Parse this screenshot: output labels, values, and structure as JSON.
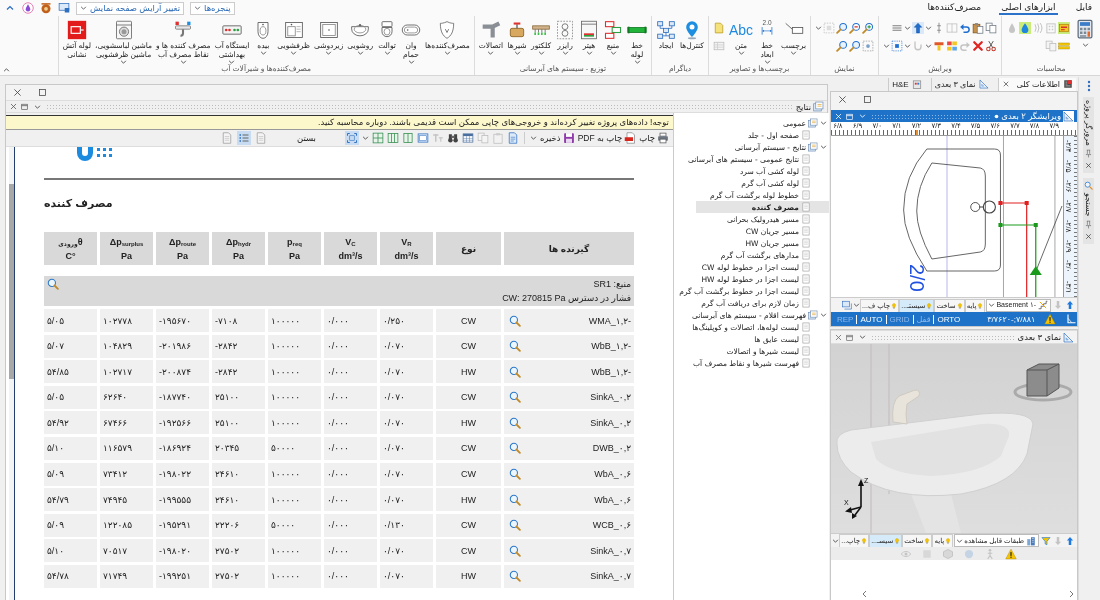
{
  "quick_access": {
    "layout_dropdown": "تغییر آرایش صفحه نمایش",
    "windows_dropdown": "پنجره‌ها"
  },
  "ribbon_tabs": [
    {
      "label": "فایل",
      "selected": false
    },
    {
      "label": "ابزارهای اصلی",
      "selected": true
    },
    {
      "label": "مصرف‌کننده‌ها",
      "selected": false
    }
  ],
  "ribbon_groups": [
    {
      "label": "محاسبات"
    },
    {
      "label": "ویرایش"
    },
    {
      "label": "نمایش"
    },
    {
      "label": "برچسب‌ها و تصاویر",
      "buttons": [
        {
          "label": "برچسب",
          "dropdown": true
        },
        {
          "label": "خط\nابعاد",
          "dropdown": true,
          "icon_text": "2.0"
        },
        {
          "label": "متن",
          "dropdown": true,
          "icon_text": "Abc"
        }
      ]
    },
    {
      "label": "دیاگرام",
      "buttons": [
        {
          "label": "کنترل‌ها",
          "dropdown": false
        },
        {
          "label": "ایجاد",
          "dropdown": false
        }
      ]
    },
    {
      "label": "توزیع - سیستم های آبرسانی",
      "buttons": [
        {
          "label": "خط\nلوله",
          "dropdown": true
        },
        {
          "label": "منبع",
          "dropdown": true
        },
        {
          "label": "هیتر",
          "dropdown": true
        },
        {
          "label": "رایزر",
          "dropdown": true
        },
        {
          "label": "کلکتور",
          "dropdown": true
        },
        {
          "label": "شیرها",
          "dropdown": true
        },
        {
          "label": "اتصالات",
          "dropdown": true
        }
      ]
    },
    {
      "label": "مصرف‌کننده‌ها و شیرآلات آب",
      "buttons": [
        {
          "label": "مصرف‌کننده‌ها",
          "dropdown": true
        },
        {
          "label": "وان\nحمام",
          "dropdown": true
        },
        {
          "label": "توالت",
          "dropdown": true
        },
        {
          "label": "روشویی",
          "dropdown": true
        },
        {
          "label": "زیردوشی",
          "dropdown": true
        },
        {
          "label": "ظرفشویی",
          "dropdown": true
        },
        {
          "label": "بیده",
          "dropdown": true
        },
        {
          "label": "ایستگاه آب\nبهداشتی",
          "dropdown": true
        },
        {
          "label": "مصرف کننده ها و\nنقاط مصرف آب",
          "dropdown": true
        },
        {
          "label": "ماشین لباسشویی،\nماشین ظرفشویی",
          "dropdown": true
        },
        {
          "label": "لوله آتش\nنشانی",
          "dropdown": false
        }
      ]
    }
  ],
  "document_tabs": [
    {
      "label": "اطلاعات کلی",
      "selected": true
    },
    {
      "label": "نمای ۳ بعدی",
      "selected": false
    },
    {
      "label": "H&E",
      "selected": false
    }
  ],
  "results_window": {
    "panel_title": "نتایج",
    "warning": "توجه! داده‌های پروژه تغییر کرده‌اند و خروجی‌های چاپی ممکن است قدیمی باشند. دوباره محاسبه کنید.",
    "toolbar": {
      "print": "چاپ",
      "print_pdf": "چاپ به PDF",
      "save": "ذخیره",
      "close": "بستن"
    },
    "fit_page": {
      "selected": true
    },
    "page_modes": [
      {
        "selected": false
      },
      {
        "selected": true
      },
      {
        "selected": false
      }
    ]
  },
  "report": {
    "title": "مصرف کننده",
    "columns": [
      {
        "name": "گیرنده ها"
      },
      {
        "name": "نوع"
      },
      {
        "name": "V$_{R}$",
        "unit": "dm³/s"
      },
      {
        "name": "V$_{C}$",
        "unit": "dm³/s"
      },
      {
        "name": "p$_{req}$",
        "unit": "Pa"
      },
      {
        "name": "Δp$_{hydr}$",
        "unit": "Pa"
      },
      {
        "name": "Δp$_{route}$",
        "unit": "Pa"
      },
      {
        "name": "Δp$_{surplus}$",
        "unit": "Pa"
      },
      {
        "name": "θ$_{ورودی}$",
        "unit": "°C"
      }
    ],
    "source": "منبع: SR1",
    "available_pressure": "فشار در دسترس CW: 270815 Pa",
    "rows": [
      [
        "WMA_۱,۲-",
        "CW",
        "۰/۲۵۰",
        "۰/۰۰۰",
        "۱۰۰۰۰۰",
        "-۷۱۰۸",
        "-۱۹۵۶۷۰",
        "۱۰۲۷۷۸",
        "۵/۰۵"
      ],
      [
        "WbB_۱,۲-",
        "CW",
        "۰/۰۷۰",
        "۰/۰۰۰",
        "۱۰۰۰۰۰",
        "-۲۸۴۲",
        "-۲۰۱۹۸۶",
        "۱۰۴۸۲۹",
        "۵/۰۷"
      ],
      [
        "WbB_۱,۲-",
        "HW",
        "۰/۰۷۰",
        "۰/۰۰۰",
        "۱۰۰۰۰۰",
        "-۲۸۴۲",
        "-۲۰۰۸۷۴",
        "۱۰۲۷۱۷",
        "۵۴/۸۵"
      ],
      [
        "SinkA_۰,۲",
        "CW",
        "۰/۰۷۰",
        "۰/۰۰۰",
        "۱۰۰۰۰۰",
        "۲۵۱۰۰",
        "-۱۸۷۷۴۰",
        "۶۲۶۴۰",
        "۵/۰۵"
      ],
      [
        "SinkA_۰,۲",
        "HW",
        "۰/۰۷۰",
        "۰/۰۰۰",
        "۱۰۰۰۰۰",
        "۲۵۱۰۰",
        "-۱۹۲۵۶۶",
        "۶۷۴۶۶",
        "۵۴/۹۲"
      ],
      [
        "DWB_۰,۲",
        "CW",
        "۰/۰۷۰",
        "۰/۰۰۰",
        "۵۰۰۰۰",
        "۲۰۳۴۵",
        "-۱۸۶۹۲۴",
        "۱۱۶۵۷۹",
        "۵/۱۰"
      ],
      [
        "WbA_۰,۶",
        "CW",
        "۰/۰۷۰",
        "۰/۰۰۰",
        "۱۰۰۰۰۰",
        "۲۴۶۱۰",
        "-۱۹۸۰۲۲",
        "۷۳۴۱۲",
        "۵/۰۹"
      ],
      [
        "WbA_۰,۶",
        "HW",
        "۰/۰۷۰",
        "۰/۰۰۰",
        "۱۰۰۰۰۰",
        "۲۴۶۱۰",
        "-۱۹۹۵۵۵",
        "۷۴۹۴۵",
        "۵۴/۷۹"
      ],
      [
        "WCB_۰,۶",
        "CW",
        "۰/۱۳۰",
        "۰/۰۰۰",
        "۵۰۰۰۰",
        "۲۲۲۰۶",
        "-۱۹۵۲۹۱",
        "۱۲۲۰۸۵",
        "۵/۰۹"
      ],
      [
        "SinkA_۰,۷",
        "CW",
        "۰/۰۷۰",
        "۰/۰۰۰",
        "۱۰۰۰۰۰",
        "۲۷۵۰۲",
        "-۱۹۸۰۲۰",
        "۷۰۵۱۷",
        "۵/۱۰"
      ],
      [
        "SinkA_۰,۷",
        "HW",
        "۰/۰۷۰",
        "۰/۰۰۰",
        "۱۰۰۰۰۰",
        "۲۷۵۰۲",
        "-۱۹۹۲۵۱",
        "۷۱۷۴۹",
        "۵۴/۷۸"
      ]
    ]
  },
  "results_tree": [
    {
      "label": "عمومی",
      "expanded": true,
      "selected": false,
      "children": [
        {
          "label": "صفحه اول - جلد",
          "selected": false
        }
      ]
    },
    {
      "label": "نتایج - سیستم آبرسانی",
      "expanded": true,
      "selected": false,
      "children": [
        {
          "label": "نتایج عمومی - سیستم های آبرسانی",
          "selected": false
        },
        {
          "label": "لوله کشی آب سرد",
          "selected": false
        },
        {
          "label": "لوله کشی آب گرم",
          "selected": false
        },
        {
          "label": "خطوط لوله برگشت آب گرم",
          "selected": false
        },
        {
          "label": "مصرف کننده",
          "selected": true
        },
        {
          "label": "مسیر هیدرولیک بحرانی",
          "selected": false
        },
        {
          "label": "مسیر جریان CW",
          "selected": false
        },
        {
          "label": "مسیر جریان HW",
          "selected": false
        },
        {
          "label": "مدارهای برگشت آب گرم",
          "selected": false
        },
        {
          "label": "لیست اجزا در خطوط لوله CW",
          "selected": false
        },
        {
          "label": "لیست اجزا در خطوط لوله HW",
          "selected": false
        },
        {
          "label": "لیست اجزا در خطوط برگشت آب گرم",
          "selected": false
        },
        {
          "label": "زمان لازم برای دریافت آب گرم",
          "selected": false
        }
      ]
    },
    {
      "label": "فهرست اقلام - سیستم های آبرسانی",
      "expanded": true,
      "selected": false,
      "children": [
        {
          "label": "لیست لوله‌ها، اتصالات و کوپلینگ‌ها",
          "selected": false
        },
        {
          "label": "لیست عایق ها",
          "selected": false
        },
        {
          "label": "لیست شیرها و اتصالات",
          "selected": false
        },
        {
          "label": "فهرست شیرها و نقاط مصرف آب",
          "selected": false
        }
      ]
    }
  ],
  "editor_2d": {
    "title": "ویرایشگر ۲ بعدی",
    "modified": true,
    "ruler_x": [
      "۷/۹",
      "۷/۸",
      "۷/۷",
      "۷/۶",
      "۷/۵",
      "۷/۴",
      "۷/۳",
      "۷/۲",
      "۷/۱",
      "۷/۰",
      "۶/۹",
      "۶/۸"
    ],
    "ruler_y": [
      "-۲/۴",
      "-۲/۵",
      "-۲/۶",
      "-۲/۷",
      "-۲/۸",
      "-۲/۹",
      "-۳/۰",
      "-۳/۱"
    ],
    "dimension_label": "2/0",
    "level_dropdown": "Basement ۱-",
    "tabs": [
      {
        "label": "پایه",
        "selected": false
      },
      {
        "label": "ساخت",
        "selected": false
      },
      {
        "label": "سیستـ...",
        "selected": true
      },
      {
        "label": "چاپ ف...",
        "selected": false
      }
    ],
    "snap_toggles": [
      {
        "label": "ORTO",
        "on": true
      },
      {
        "label": "قفل",
        "on": false
      },
      {
        "label": "GRID",
        "on": false
      },
      {
        "label": "AUTO",
        "on": true
      },
      {
        "label": "REP",
        "on": false
      }
    ],
    "coordinates": "۳/۷۶۲۰-;۷/۸۸۱"
  },
  "view_3d": {
    "title": "نمای ۳ بعدی",
    "axes": [
      "Z",
      "X"
    ],
    "layers_dropdown": "طبقات قابل مشاهده",
    "tabs": [
      {
        "label": "پایه",
        "selected": false
      },
      {
        "label": "ساخت",
        "selected": false
      },
      {
        "label": "سیسـ...",
        "selected": true
      },
      {
        "label": "چاپ...",
        "selected": false
      }
    ]
  },
  "side_tabs": [
    {
      "label": "مرورگر پروژه"
    },
    {
      "label": "جستجو"
    }
  ]
}
